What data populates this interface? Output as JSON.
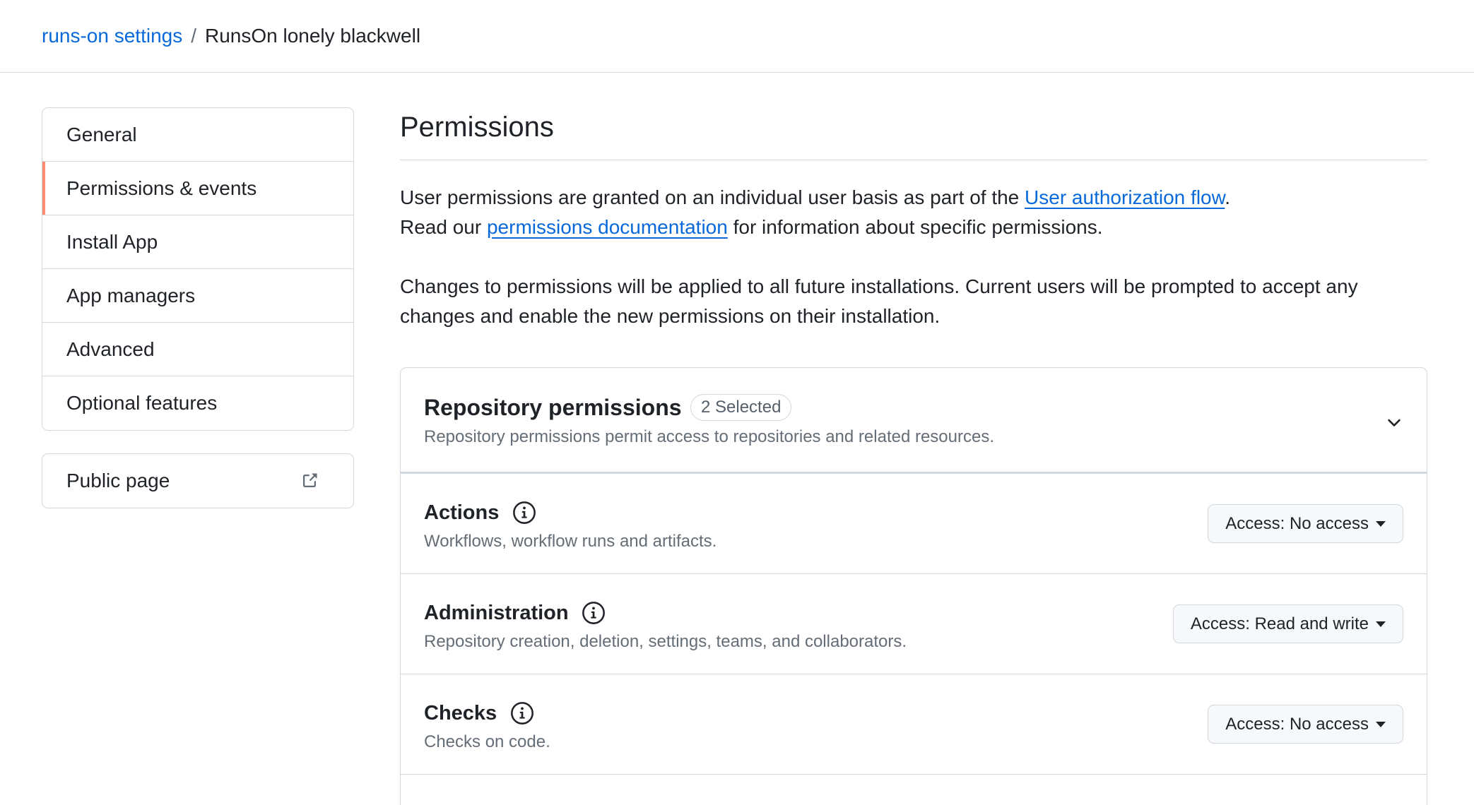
{
  "breadcrumb": {
    "parent": "runs-on settings",
    "separator": "/",
    "current": "RunsOn lonely blackwell"
  },
  "sidebar": {
    "items": [
      {
        "label": "General"
      },
      {
        "label": "Permissions & events",
        "selected": true
      },
      {
        "label": "Install App"
      },
      {
        "label": "App managers"
      },
      {
        "label": "Advanced"
      },
      {
        "label": "Optional features"
      }
    ],
    "public_page": "Public page"
  },
  "main": {
    "title": "Permissions",
    "intro1_pre": "User permissions are granted on an individual user basis as part of the ",
    "intro1_link": "User authorization flow",
    "intro1_post": ".",
    "intro2_pre": "Read our ",
    "intro2_link": "permissions documentation",
    "intro2_post": " for information about specific permissions.",
    "intro3": "Changes to permissions will be applied to all future installations. Current users will be prompted to accept any changes and enable the new permissions on their installation."
  },
  "repo_permissions": {
    "title": "Repository permissions",
    "badge": "2 Selected",
    "subtitle": "Repository permissions permit access to repositories and related resources.",
    "rows": [
      {
        "title": "Actions",
        "desc": "Workflows, workflow runs and artifacts.",
        "access": "Access: No access"
      },
      {
        "title": "Administration",
        "desc": "Repository creation, deletion, settings, teams, and collaborators.",
        "access": "Access: Read and write"
      },
      {
        "title": "Checks",
        "desc": "Checks on code.",
        "access": "Access: No access"
      }
    ]
  },
  "colors": {
    "link": "#0969da",
    "selected_indicator": "#fd8c73",
    "border": "#d0d7de",
    "muted_text": "#656d76"
  }
}
